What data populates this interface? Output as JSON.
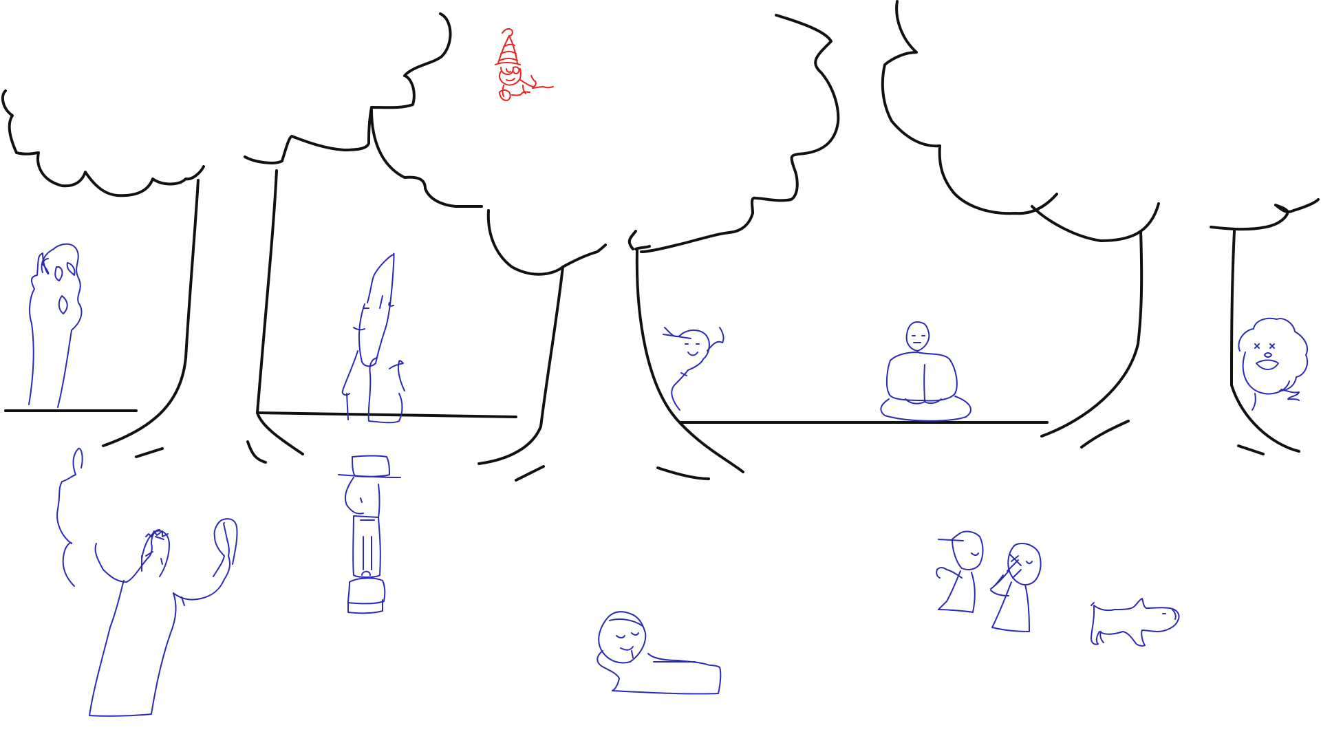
{
  "scene": {
    "background_color": "#ffffff",
    "palette": {
      "tree_ink": "#111111",
      "figure_ink": "#2a2ab8",
      "hidden_character_ink": "#e8231c"
    },
    "elements": [
      "trees",
      "ground-lines",
      "ghost",
      "old-man-with-cane",
      "peeking-kid",
      "meditating-monk",
      "clown",
      "hidden-striped-hat-character",
      "man-in-hat-with-bag",
      "bodybuilder",
      "sleeping-person",
      "two-kids-pointing",
      "dog"
    ]
  }
}
